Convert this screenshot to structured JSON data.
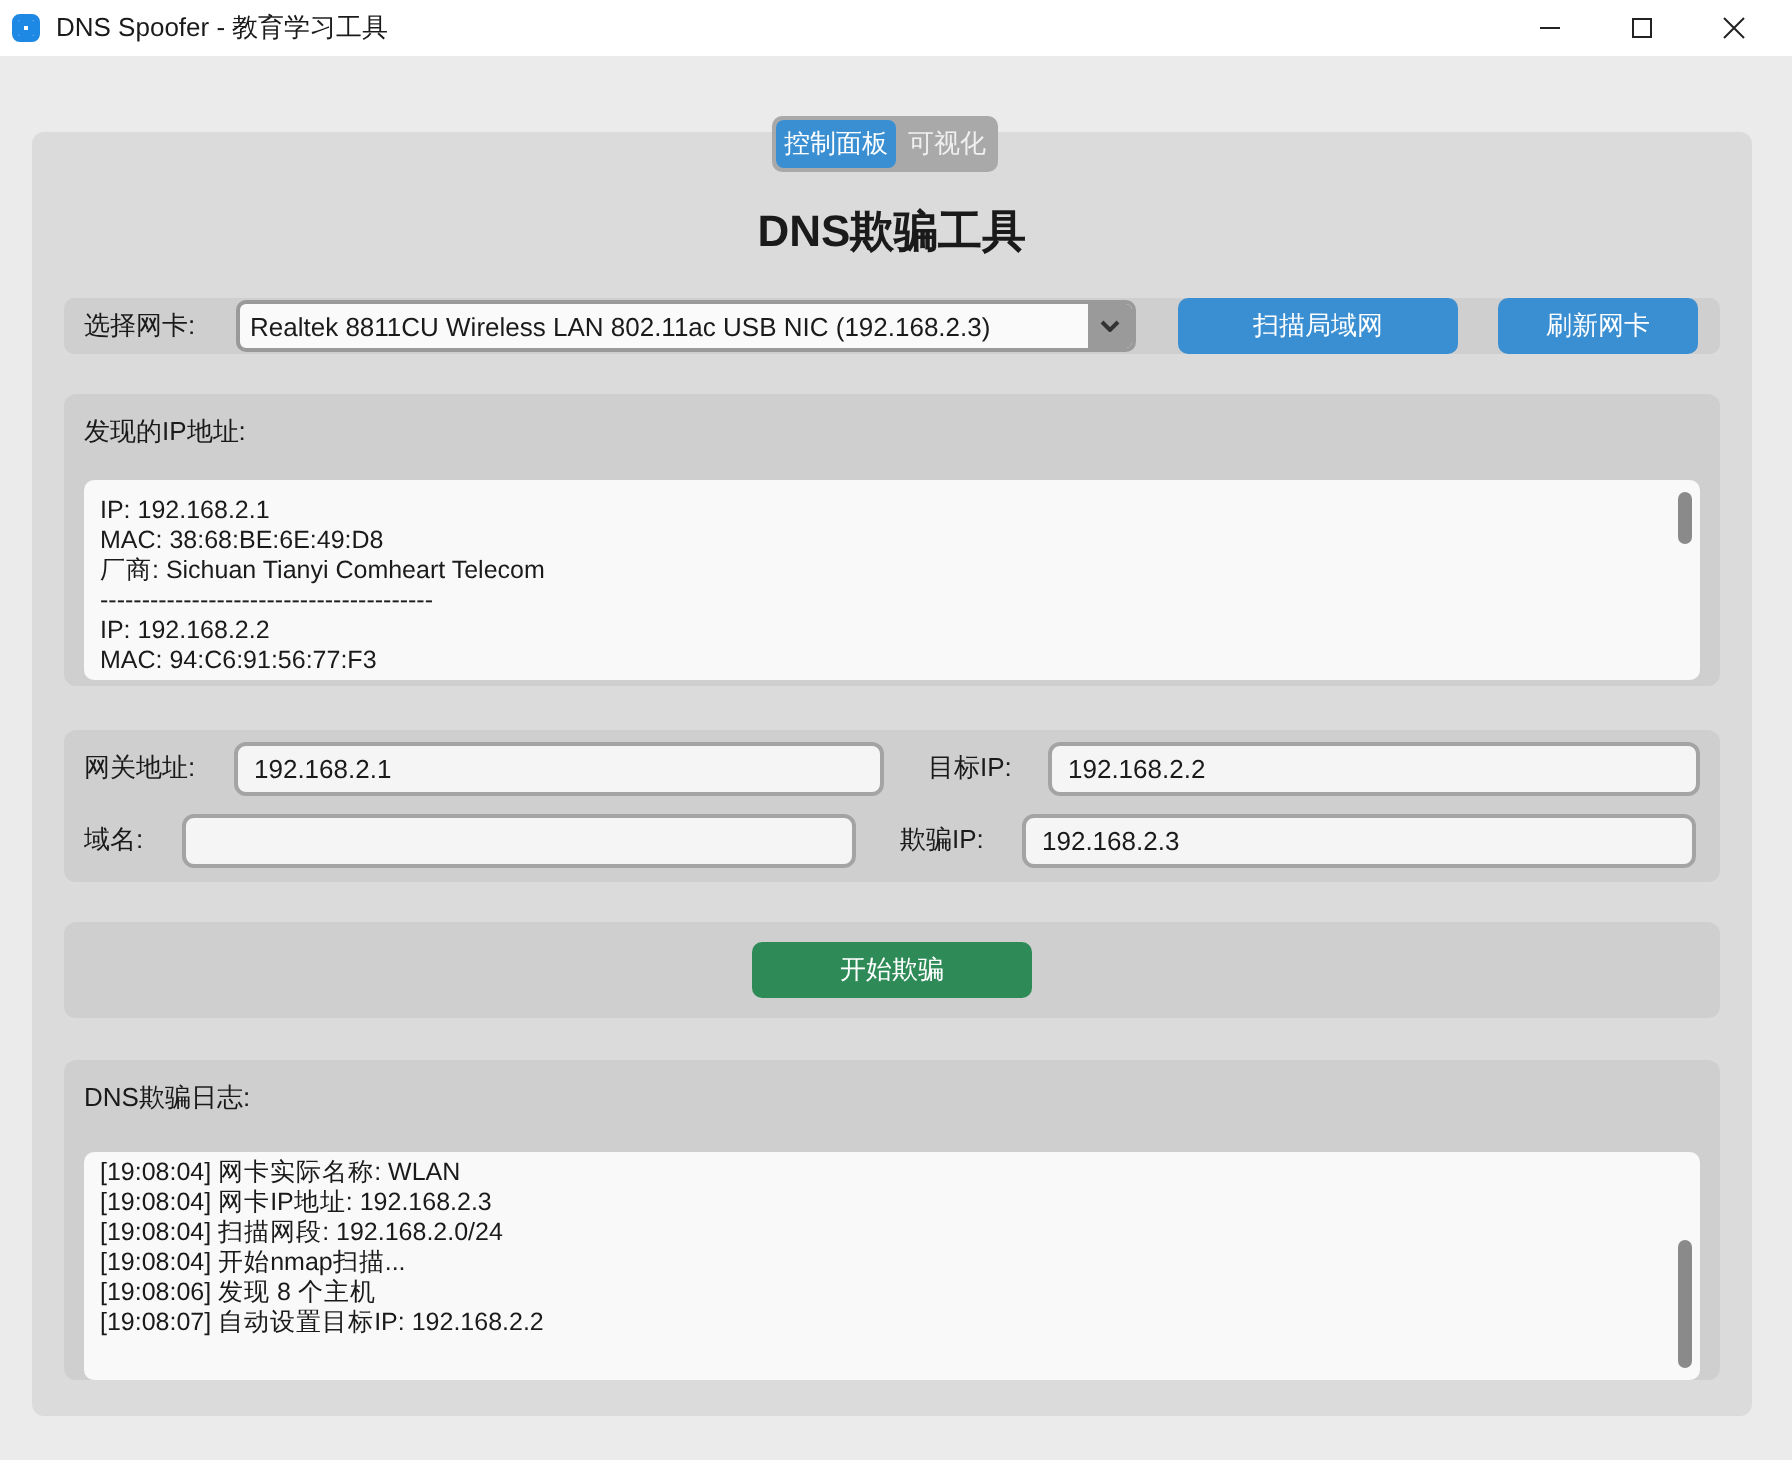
{
  "window": {
    "title": "DNS Spoofer - 教育学习工具"
  },
  "tabs": [
    {
      "label": "控制面板",
      "selected": true
    },
    {
      "label": "可视化",
      "selected": false
    }
  ],
  "heading": "DNS欺骗工具",
  "adapter": {
    "label": "选择网卡:",
    "value": "Realtek 8811CU Wireless LAN 802.11ac USB NIC (192.168.2.3)"
  },
  "adapter_buttons": [
    "扫描局域网",
    "刷新网卡"
  ],
  "discovered": {
    "label": "发现的IP地址:",
    "lines": [
      "IP: 192.168.2.1",
      "MAC: 38:68:BE:6E:49:D8",
      "厂商: Sichuan Tianyi Comheart Telecom",
      "----------------------------------------",
      "IP: 192.168.2.2",
      "MAC: 94:C6:91:56:77:F3"
    ]
  },
  "fields": [
    [
      {
        "label": "网关地址:",
        "value": "192.168.2.1"
      },
      {
        "label": "目标IP:",
        "value": "192.168.2.2"
      }
    ],
    [
      {
        "label": "域名:"
      },
      {
        "label": "欺骗IP:",
        "value": "192.168.2.3"
      }
    ]
  ],
  "start_button": "开始欺骗",
  "log": {
    "label": "DNS欺骗日志:",
    "lines": [
      "[19:08:04] 网卡实际名称: WLAN",
      "[19:08:04] 网卡IP地址: 192.168.2.3",
      "[19:08:04] 扫描网段: 192.168.2.0/24",
      "[19:08:04] 开始nmap扫描...",
      "[19:08:06] 发现 8 个主机",
      "[19:08:07] 自动设置目标IP: 192.168.2.2"
    ]
  }
}
